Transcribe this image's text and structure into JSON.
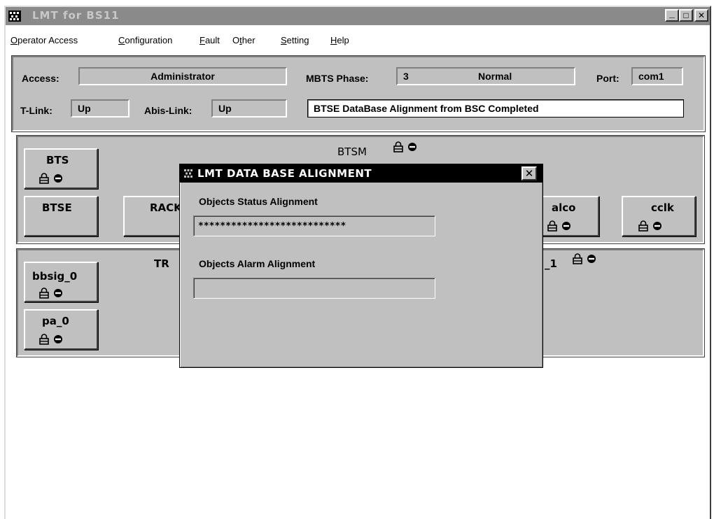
{
  "window": {
    "title": "LMT  for  BS11",
    "controls": {
      "minimize": "_",
      "maximize": "□",
      "close": "✕"
    }
  },
  "menu": [
    {
      "label": "Operator Access",
      "accel_index": 0
    },
    {
      "label": "Configuration",
      "accel_index": 0
    },
    {
      "label": "Fault",
      "accel_index": 0
    },
    {
      "label": "Other",
      "accel_index": 1
    },
    {
      "label": "Setting",
      "accel_index": 0
    },
    {
      "label": "Help",
      "accel_index": 0
    }
  ],
  "status": {
    "access_label": "Access:",
    "access_value": "Administrator",
    "phase_label": "MBTS Phase:",
    "phase_number": "3",
    "phase_state": "Normal",
    "port_label": "Port:",
    "port_value": "com1",
    "tlink_label": "T-Link:",
    "tlink_value": "Up",
    "abis_label": "Abis-Link:",
    "abis_value": "Up",
    "message": "BTSE DataBase Alignment from BSC Completed"
  },
  "btsm": {
    "title": "BTSM",
    "objects": {
      "bts": "BTS",
      "btse": "BTSE",
      "rack": "RACK",
      "alco": "alco",
      "cclk": "cclk"
    }
  },
  "trx": {
    "title_left": "TR",
    "title_right": "_1",
    "objects": {
      "bbsig": "bbsig_0",
      "pa": "pa_0"
    }
  },
  "dialog": {
    "title": "LMT DATA BASE ALIGNMENT",
    "close": "✕",
    "status_label": "Objects Status Alignment",
    "status_progress": "***************************",
    "alarm_label": "Objects Alarm Alignment",
    "alarm_progress": ""
  },
  "icons": [
    "lock-icon",
    "no-entry-icon",
    "app-icon",
    "minimize-icon",
    "maximize-icon",
    "close-icon"
  ],
  "colors": {
    "face": "#c0c0c0",
    "inactive_title": "#8a8a8a",
    "dialog_title": "#000000"
  }
}
